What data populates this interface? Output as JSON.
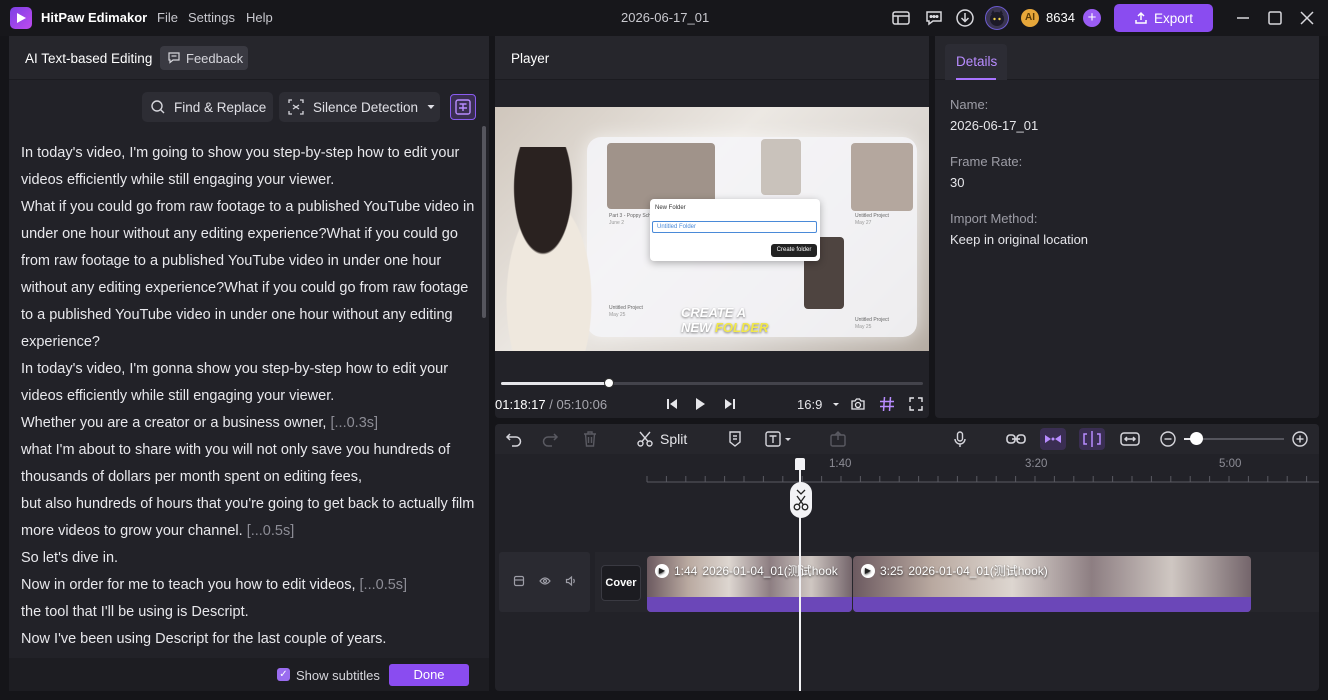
{
  "app": {
    "name": "HitPaw Edimakor",
    "menus": [
      "File",
      "Settings",
      "Help"
    ],
    "project_title": "2026-06-17_01",
    "credits": "8634",
    "coin_label": "AI",
    "export_label": "Export"
  },
  "left_panel": {
    "title": "AI Text-based Editing",
    "feedback_label": "Feedback",
    "find_replace_label": "Find & Replace",
    "silence_label": "Silence Detection",
    "transcript": [
      {
        "text": "In today's video, I'm going to show you step-by-step how to edit your videos efficiently while still engaging your viewer.",
        "gap": ""
      },
      {
        "text": "What if you could go from raw footage to a published YouTube video in under one hour without any editing experience?What if you could go from raw footage to a published YouTube video in under one hour without any editing experience?What if you could go from raw footage to a published YouTube video in under one hour without any editing experience?",
        "gap": ""
      },
      {
        "text": "In today's video, I'm gonna show you step-by-step how to edit your videos efficiently while still engaging your viewer.",
        "gap": ""
      },
      {
        "text": "Whether you are a creator or a business owner,",
        "gap": "[...0.3s]"
      },
      {
        "text": "what I'm about to share with you will not only save you hundreds of thousands of dollars per month spent on editing fees,",
        "gap": ""
      },
      {
        "text": "but also hundreds of hours that you're going to get back to actually film more videos to grow your channel.",
        "gap": "[...0.5s]"
      },
      {
        "text": "So let's dive in.",
        "gap": ""
      },
      {
        "text": "Now in order for me to teach you how to edit videos,",
        "gap": "[...0.5s]"
      },
      {
        "text": "the tool that I'll be using is Descript.",
        "gap": ""
      },
      {
        "text": "Now I've been using Descript for the last couple of years.",
        "gap": ""
      }
    ],
    "show_subtitles_label": "Show subtitles",
    "show_subtitles_checked": true,
    "done_label": "Done"
  },
  "player": {
    "title": "Player",
    "current_time": "01:18:17",
    "total_time": "/ 05:10:06",
    "progress_fraction": 0.255,
    "aspect_ratio": "16:9",
    "video_overlay": {
      "dialog_title": "New Folder",
      "dialog_input": "Untitled Folder",
      "dialog_button": "Create folder",
      "caption_line1": "CREATE A",
      "caption_line2_white": "NEW",
      "caption_line2_yellow": "FOLDER",
      "thumb_labels": [
        "Part 3 - Poppy Sch",
        "Untitled Project",
        "Untitled Project",
        "Untitled Project"
      ],
      "thumb_dates": [
        "June 2",
        "May 27",
        "May 25",
        "May 25"
      ]
    }
  },
  "details": {
    "tab_label": "Details",
    "fields": [
      {
        "label": "Name:",
        "value": "2026-06-17_01"
      },
      {
        "label": "Frame Rate:",
        "value": "30"
      },
      {
        "label": "Import Method:",
        "value": "Keep in original location"
      }
    ]
  },
  "timeline": {
    "split_label": "Split",
    "ruler_labels": [
      "1:40",
      "3:20",
      "5:00"
    ],
    "cover_label": "Cover",
    "clips": [
      {
        "duration": "1:44",
        "name": "2026-01-04_01(测试hook"
      },
      {
        "duration": "3:25",
        "name": "2026-01-04_01(测试hook)"
      }
    ],
    "zoom_fraction": 0.12
  },
  "colors": {
    "accent": "#8a4cf0",
    "accent_light": "#b88cff",
    "panel_bg": "#222228",
    "app_bg": "#151519",
    "waveform": "#6b47b8"
  }
}
